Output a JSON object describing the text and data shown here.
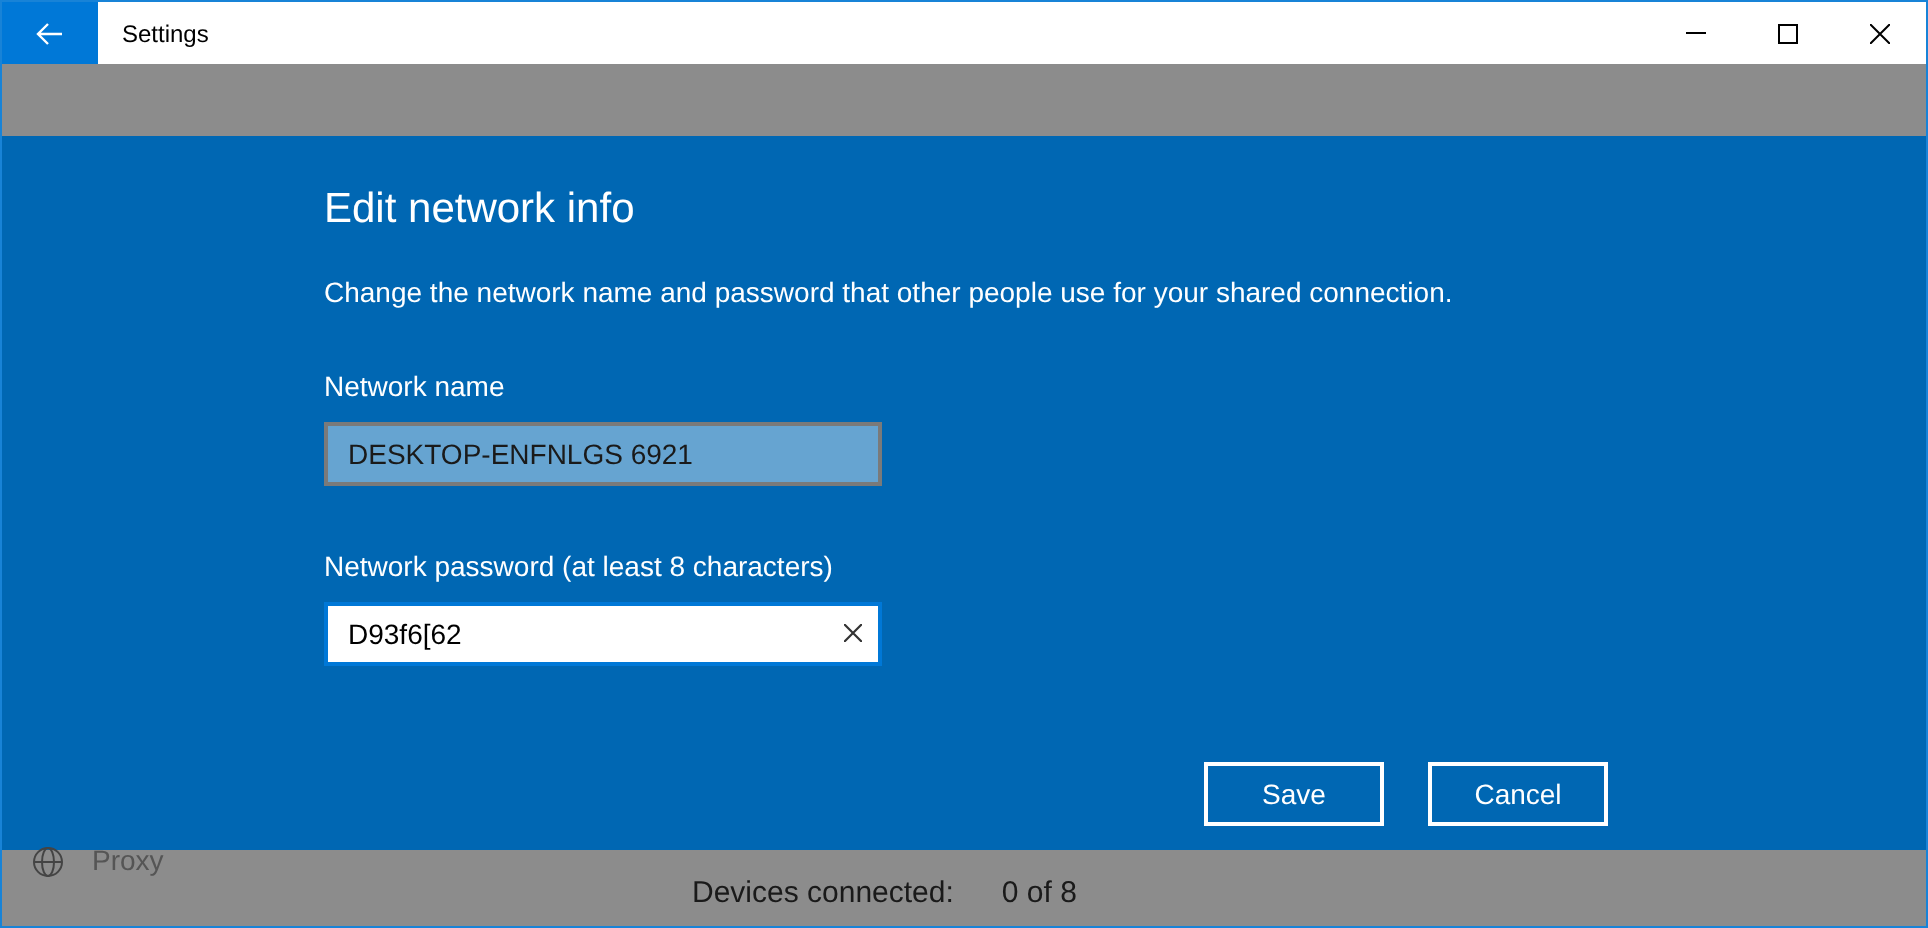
{
  "window": {
    "title": "Settings"
  },
  "sidebar": {
    "items": [
      {
        "label": "Proxy"
      }
    ]
  },
  "background": {
    "devices_label": "Devices connected:",
    "devices_value": "0 of 8"
  },
  "dialog": {
    "title": "Edit network info",
    "description": "Change the network name and password that other people use for your shared connection.",
    "fields": [
      {
        "label": "Network name",
        "value": "DESKTOP-ENFNLGS 6921",
        "focused": false
      },
      {
        "label": "Network password (at least 8 characters)",
        "value": "D93f6[62",
        "focused": true
      }
    ],
    "buttons": [
      "Save",
      "Cancel"
    ]
  }
}
